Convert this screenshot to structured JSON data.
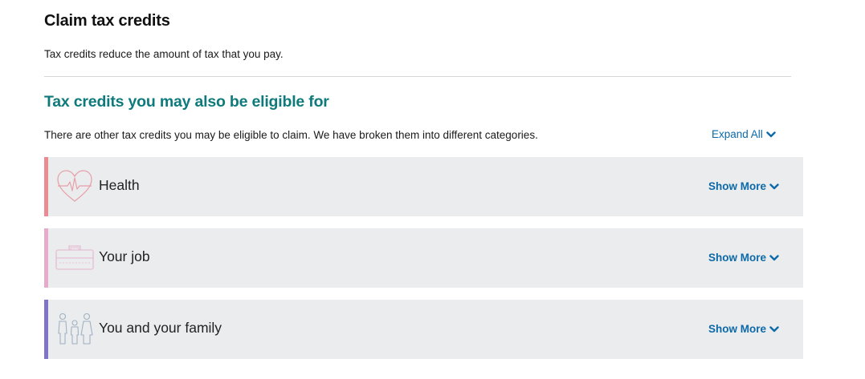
{
  "header": {
    "title": "Claim tax credits",
    "intro": "Tax credits reduce the amount of tax that you pay."
  },
  "eligible_section": {
    "heading": "Tax credits you may also be eligible for",
    "description": "There are other tax credits you may be eligible to claim. We have broken them into different categories.",
    "expand_all_label": "Expand All"
  },
  "categories": [
    {
      "label": "Health",
      "show_more_label": "Show More",
      "icon": "heart-pulse-icon",
      "accent_color": "#ea8a93"
    },
    {
      "label": "Your job",
      "show_more_label": "Show More",
      "icon": "briefcase-icon",
      "accent_color": "#e8aacb"
    },
    {
      "label": "You and your family",
      "show_more_label": "Show More",
      "icon": "family-icon",
      "accent_color": "#7f74c9"
    }
  ],
  "colors": {
    "heading_teal": "#0f7a7b",
    "link_blue": "#0d6aa8",
    "card_background": "#ebecee"
  }
}
